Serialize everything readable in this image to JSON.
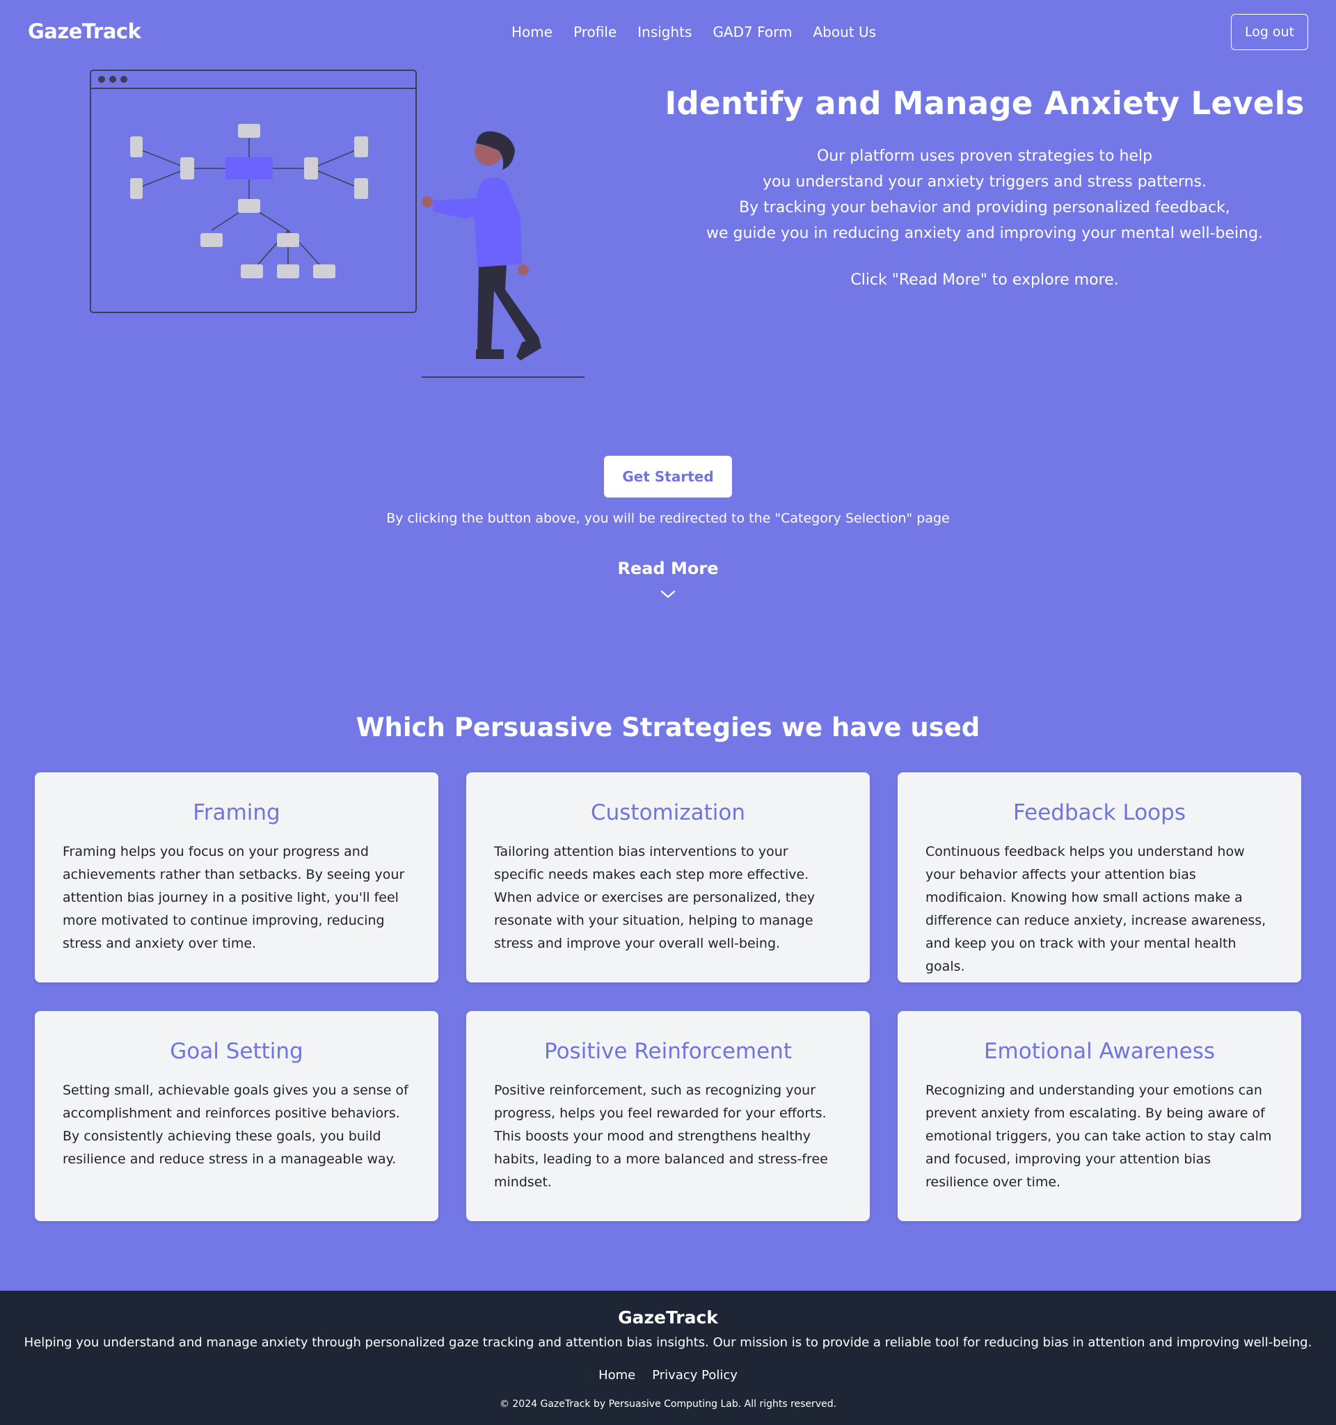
{
  "nav": {
    "brand": "GazeTrack",
    "links": [
      "Home",
      "Profile",
      "Insights",
      "GAD7 Form",
      "About Us"
    ],
    "logout_label": "Log out"
  },
  "hero": {
    "title": "Identify and Manage Anxiety Levels",
    "description_lines": [
      "Our platform uses proven strategies to help",
      "you understand your anxiety triggers and stress patterns.",
      "By tracking your behavior and providing personalized feedback,",
      "we guide you in reducing anxiety and improving your mental well-being."
    ],
    "read_hint": "Click \"Read More\" to explore more.",
    "cta_label": "Get Started",
    "cta_note": "By clicking the button above, you will be redirected to the \"Category Selection\" page",
    "read_more_label": "Read More"
  },
  "strategies": {
    "title": "Which Persuasive Strategies we have used",
    "cards": [
      {
        "title": "Framing",
        "text": "Framing helps you focus on your progress and achievements rather than setbacks. By seeing your attention bias journey in a positive light, you'll feel more motivated to continue improving, reducing stress and anxiety over time."
      },
      {
        "title": "Customization",
        "text": "Tailoring attention bias interventions to your specific needs makes each step more effective. When advice or exercises are personalized, they resonate with your situation, helping to manage stress and improve your overall well-being."
      },
      {
        "title": "Feedback Loops",
        "text": "Continuous feedback helps you understand how your behavior affects your attention bias modificaion. Knowing how small actions make a difference can reduce anxiety, increase awareness, and keep you on track with your mental health goals."
      },
      {
        "title": "Goal Setting",
        "text": "Setting small, achievable goals gives you a sense of accomplishment and reinforces positive behaviors. By consistently achieving these goals, you build resilience and reduce stress in a manageable way."
      },
      {
        "title": "Positive Reinforcement",
        "text": "Positive reinforcement, such as recognizing your progress, helps you feel rewarded for your efforts. This boosts your mood and strengthens healthy habits, leading to a more balanced and stress-free mindset."
      },
      {
        "title": "Emotional Awareness",
        "text": "Recognizing and understanding your emotions can prevent anxiety from escalating. By being aware of emotional triggers, you can take action to stay calm and focused, improving your attention bias resilience over time."
      }
    ]
  },
  "footer": {
    "brand": "GazeTrack",
    "mission": "Helping you understand and manage anxiety through personalized gaze tracking and attention bias insights. Our mission is to provide a reliable tool for reducing bias in attention and improving well-being.",
    "links": [
      "Home",
      "Privacy Policy"
    ],
    "copyright": "© 2024 GazeTrack by Persuasive Computing Lab. All rights reserved."
  },
  "colors": {
    "background": "#7478e6",
    "accent": "#6f74e0",
    "card_bg": "#f3f4f6",
    "footer_bg": "#1e2636"
  },
  "icons": {
    "read_more": "chevron-down-icon",
    "illustration": "mind-map-presenter-illustration"
  }
}
